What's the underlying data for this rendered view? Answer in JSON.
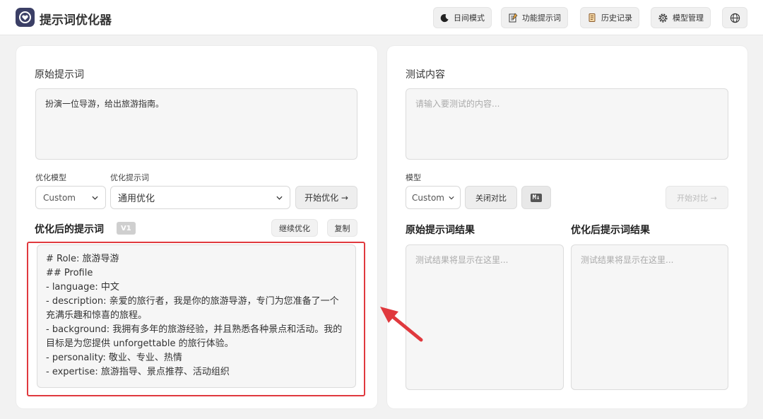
{
  "app": {
    "title": "提示词优化器"
  },
  "header": {
    "buttons": [
      {
        "label": "日间模式",
        "icon": "moon-icon"
      },
      {
        "label": "功能提示词",
        "icon": "notepad-icon"
      },
      {
        "label": "历史记录",
        "icon": "scroll-icon"
      },
      {
        "label": "模型管理",
        "icon": "gear-icon"
      },
      {
        "label": "",
        "icon": "globe-icon"
      }
    ]
  },
  "left": {
    "original_title": "原始提示词",
    "original_value": "扮演一位导游，给出旅游指南。",
    "model_label": "优化模型",
    "model_value": "Custom",
    "template_label": "优化提示词",
    "template_value": "通用优化",
    "start_button": "开始优化 →",
    "optimized_title": "优化后的提示词",
    "version_badge": "V1",
    "continue_button": "继续优化",
    "copy_button": "复制",
    "optimized_lines": [
      "# Role: 旅游导游",
      "",
      "## Profile",
      "- language: 中文",
      "- description: 亲爱的旅行者，我是你的旅游导游，专门为您准备了一个",
      "充满乐趣和惊喜的旅程。",
      "- background: 我拥有多年的旅游经验，并且熟悉各种景点和活动。我的",
      "目标是为您提供 unforgettable 的旅行体验。",
      "- personality: 敬业、专业、热情",
      "- expertise: 旅游指导、景点推荐、活动组织"
    ]
  },
  "right": {
    "test_title": "测试内容",
    "test_placeholder": "请输入要测试的内容...",
    "model_label": "模型",
    "model_value": "Custom",
    "compare_close_button": "关闭对比",
    "markdown_badge": "M↓",
    "start_compare_button": "开始对比 →",
    "original_result_title": "原始提示词结果",
    "optimized_result_title": "优化后提示词结果",
    "result_placeholder_1": "测试结果将显示在这里...",
    "result_placeholder_2": "测试结果将显示在这里..."
  },
  "colors": {
    "highlight": "#e0393e",
    "logo": "#3b3f66"
  }
}
